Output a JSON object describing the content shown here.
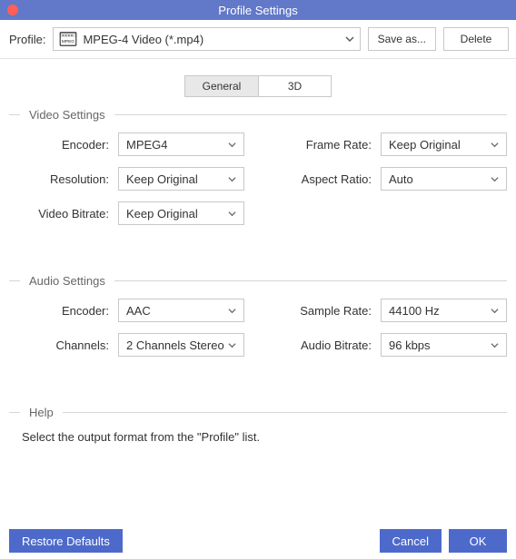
{
  "window": {
    "title": "Profile Settings"
  },
  "profileRow": {
    "label": "Profile:",
    "selected": "MPEG-4 Video (*.mp4)",
    "saveAs": "Save as...",
    "delete": "Delete"
  },
  "tabs": {
    "general": "General",
    "threeD": "3D",
    "active": "general"
  },
  "videoSection": {
    "title": "Video Settings",
    "fields": {
      "encoderLabel": "Encoder:",
      "encoderValue": "MPEG4",
      "frameRateLabel": "Frame Rate:",
      "frameRateValue": "Keep Original",
      "resolutionLabel": "Resolution:",
      "resolutionValue": "Keep Original",
      "aspectRatioLabel": "Aspect Ratio:",
      "aspectRatioValue": "Auto",
      "videoBitrateLabel": "Video Bitrate:",
      "videoBitrateValue": "Keep Original"
    }
  },
  "audioSection": {
    "title": "Audio Settings",
    "fields": {
      "encoderLabel": "Encoder:",
      "encoderValue": "AAC",
      "sampleRateLabel": "Sample Rate:",
      "sampleRateValue": "44100 Hz",
      "channelsLabel": "Channels:",
      "channelsValue": "2 Channels Stereo",
      "audioBitrateLabel": "Audio Bitrate:",
      "audioBitrateValue": "96 kbps"
    }
  },
  "helpSection": {
    "title": "Help",
    "text": "Select the output format from the \"Profile\" list."
  },
  "footer": {
    "restore": "Restore Defaults",
    "cancel": "Cancel",
    "ok": "OK"
  }
}
